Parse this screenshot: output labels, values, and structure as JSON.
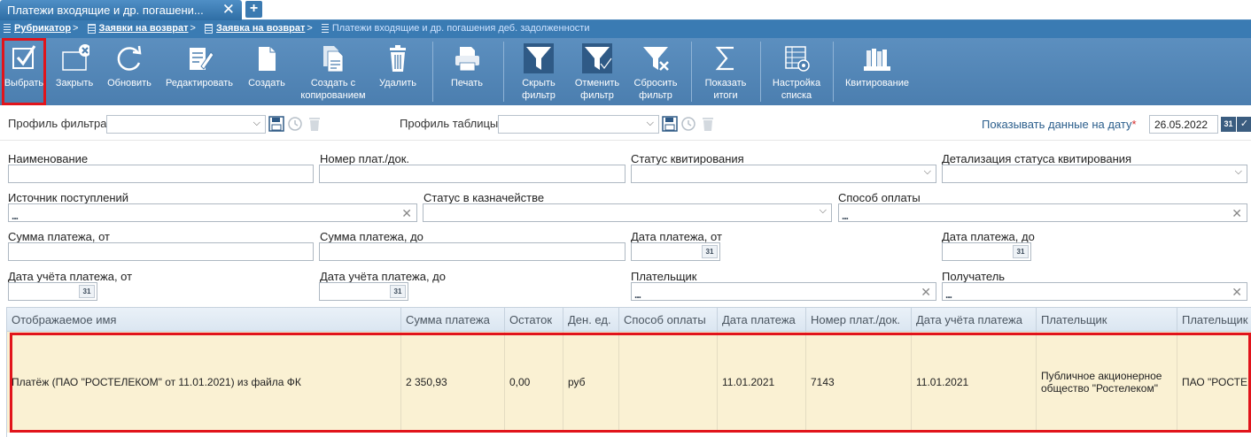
{
  "tab": {
    "title": "Платежи входящие и др. погашени...",
    "close": "✕",
    "add": "+"
  },
  "breadcrumbs": [
    {
      "label": "Рубрикатор"
    },
    {
      "label": "Заявки на возврат"
    },
    {
      "label": "Заявка на возврат"
    },
    {
      "label": "Платежи входящие и др. погашения деб. задолженности"
    }
  ],
  "toolbar": {
    "select": "Выбрать",
    "close": "Закрыть",
    "refresh": "Обновить",
    "edit": "Редактировать",
    "create": "Создать",
    "create_copy": "Создать с копированием",
    "delete": "Удалить",
    "print": "Печать",
    "hide_filter": "Скрыть фильтр",
    "cancel_filter": "Отменить фильтр",
    "reset_filter": "Сбросить фильтр",
    "show_totals": "Показать итоги",
    "list_settings": "Настройка списка",
    "reconcile": "Квитирование"
  },
  "filterbar": {
    "filter_profile_label": "Профиль фильтра:",
    "table_profile_label": "Профиль таблицы:",
    "show_date_label": "Показывать данные на дату",
    "required_mark": "*",
    "show_date_value": "26.05.2022",
    "cal_label": "31",
    "ok_label": "✓"
  },
  "form": {
    "name": "Наименование",
    "doc_number": "Номер плат./док.",
    "reconcile_status": "Статус квитирования",
    "reconcile_detail": "Детализация статуса квитирования",
    "source": "Источник поступлений",
    "treasury_status": "Статус в казначействе",
    "payment_method": "Способ оплаты",
    "sum_from": "Сумма платежа, от",
    "sum_to": "Сумма платежа, до",
    "date_from": "Дата платежа, от",
    "date_to": "Дата платежа, до",
    "account_date_from": "Дата учёта платежа, от",
    "account_date_to": "Дата учёта платежа, до",
    "payer": "Плательщик",
    "recipient": "Получатель",
    "cal": "31",
    "dots": "...",
    "clear": "✕",
    "dropdown": "⌵"
  },
  "grid": {
    "headers": [
      "Отображаемое имя",
      "Сумма платежа",
      "Остаток",
      "Ден. ед.",
      "Способ оплаты",
      "Дата платежа",
      "Номер плат./док.",
      "Дата учёта платежа",
      "Плательщик",
      "Плательщик"
    ],
    "row": [
      "Платёж (ПАО \"РОСТЕЛЕКОМ\" от 11.01.2021) из файла ФК",
      "2 350,93",
      "0,00",
      "руб",
      "",
      "11.01.2021",
      "7143",
      "11.01.2021",
      "Публичное акционерное общество \"Ростелеком\"",
      "ПАО \"РОСТЕ"
    ]
  },
  "colors": {
    "toolbar": "#4b7eaf",
    "breadcrumb": "#3a7bb3",
    "row_bg": "#faf1d3",
    "highlight": "#e1141b"
  }
}
